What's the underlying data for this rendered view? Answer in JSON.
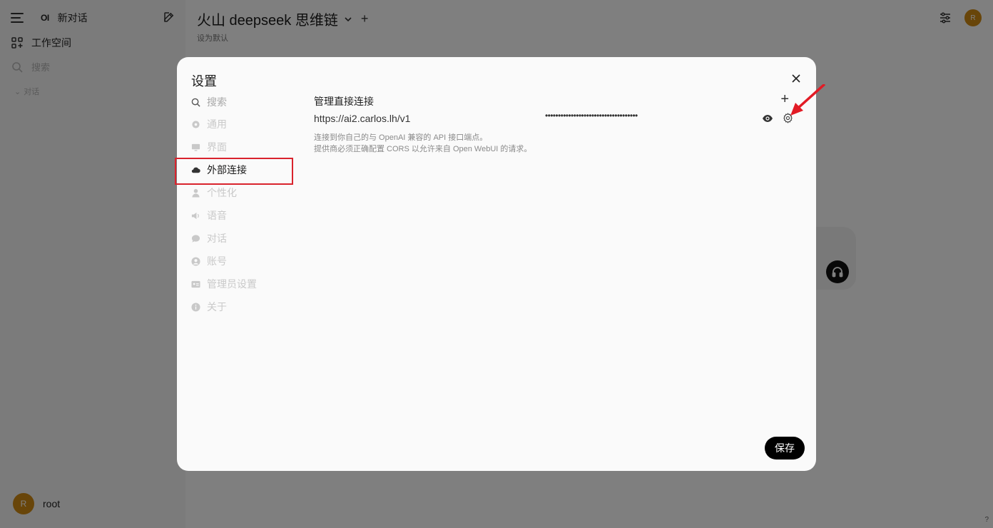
{
  "sidebar": {
    "logo": "OI",
    "new_chat": "新对话",
    "workspace": "工作空间",
    "search_placeholder": "搜索",
    "chats": "对话",
    "user": {
      "initial": "R",
      "name": "root"
    }
  },
  "header": {
    "model": "火山 deepseek 思维链",
    "add": "+",
    "set_default": "设为默认",
    "avatar_initial": "R"
  },
  "help_label": "?",
  "modal": {
    "title": "设置",
    "nav": [
      {
        "label": "搜索",
        "icon": "search-icon"
      },
      {
        "label": "通用",
        "icon": "gear-icon"
      },
      {
        "label": "界面",
        "icon": "monitor-icon"
      },
      {
        "label": "外部连接",
        "icon": "cloud-icon",
        "active": true
      },
      {
        "label": "个性化",
        "icon": "user-icon"
      },
      {
        "label": "语音",
        "icon": "speaker-icon"
      },
      {
        "label": "对话",
        "icon": "chat-bubble-icon"
      },
      {
        "label": "账号",
        "icon": "account-icon"
      },
      {
        "label": "管理员设置",
        "icon": "admin-card-icon"
      },
      {
        "label": "关于",
        "icon": "info-icon"
      }
    ],
    "section_title": "管理直接连接",
    "add_label": "+",
    "connection": {
      "url": "https://ai2.carlos.lh/v1",
      "masked_key": "••••••••••••••••••••••••••••••••••••"
    },
    "help_line1": "连接到你自己的与 OpenAI 兼容的 API 接口端点。",
    "help_line2": "提供商必须正确配置 CORS 以允许来自 Open WebUI 的请求。",
    "save": "保存"
  },
  "colors": {
    "accent_highlight": "#d9232d",
    "avatar": "#d08a12",
    "save_button": "#000000"
  }
}
